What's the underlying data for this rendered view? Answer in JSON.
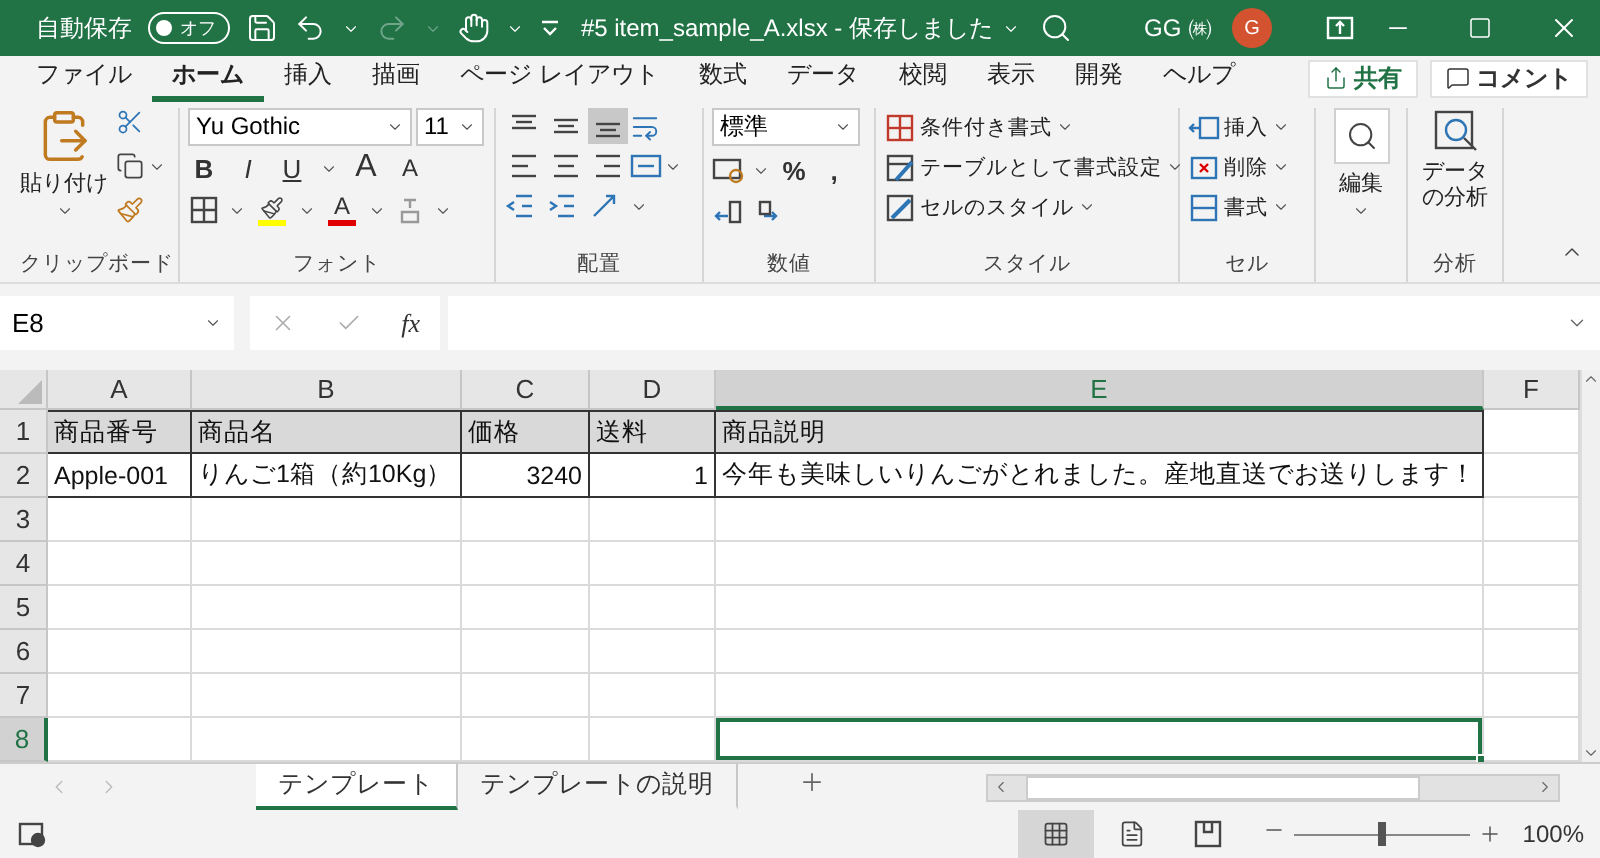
{
  "title_bar": {
    "autosave_label": "自動保存",
    "autosave_toggle": {
      "label": "オフ",
      "on": false
    },
    "title": "#5 item_sample_A.xlsx - 保存しました",
    "user": "GG ㈱",
    "avatar": "G"
  },
  "ribbon_tabs": [
    {
      "label": "ファイル",
      "selected": false
    },
    {
      "label": "ホーム",
      "selected": true
    },
    {
      "label": "挿入",
      "selected": false
    },
    {
      "label": "描画",
      "selected": false
    },
    {
      "label": "ページ レイアウト",
      "selected": false
    },
    {
      "label": "数式",
      "selected": false
    },
    {
      "label": "データ",
      "selected": false
    },
    {
      "label": "校閲",
      "selected": false
    },
    {
      "label": "表示",
      "selected": false
    },
    {
      "label": "開発",
      "selected": false
    },
    {
      "label": "ヘルプ",
      "selected": false
    }
  ],
  "share_button": "共有",
  "comment_button": "コメント",
  "ribbon": {
    "clipboard": {
      "paste": "貼り付け",
      "label": "クリップボード"
    },
    "font": {
      "name": "Yu Gothic",
      "size": "11",
      "style_buttons": [
        {
          "kind": "bold",
          "text": "B"
        },
        {
          "kind": "italic",
          "text": "I"
        },
        {
          "kind": "underline",
          "text": "U"
        },
        {
          "kind": "grow",
          "text": "A"
        },
        {
          "kind": "shrink",
          "text": "A"
        }
      ],
      "color_buttons": [
        {
          "kind": "fill",
          "color": "#ffff00"
        },
        {
          "kind": "font",
          "text": "A",
          "color": "#e00000"
        }
      ],
      "label": "フォント"
    },
    "alignment": {
      "vertical": [
        {
          "kind": "top",
          "selected": false
        },
        {
          "kind": "middle",
          "selected": false
        },
        {
          "kind": "bottom",
          "selected": true
        }
      ],
      "horizontal": [
        {
          "kind": "left",
          "selected": false
        },
        {
          "kind": "center",
          "selected": false
        },
        {
          "kind": "right",
          "selected": false
        }
      ],
      "label": "配置"
    },
    "number": {
      "format": "標準",
      "symbols": [
        "%",
        ","
      ],
      "label": "数値"
    },
    "styles": {
      "items": [
        {
          "kind": "conditional",
          "label": "条件付き書式"
        },
        {
          "kind": "table",
          "label": "テーブルとして書式設定"
        },
        {
          "kind": "cell_style",
          "label": "セルのスタイル"
        }
      ],
      "label": "スタイル"
    },
    "cells": {
      "items": [
        {
          "kind": "insert",
          "label": "挿入"
        },
        {
          "kind": "delete",
          "label": "削除"
        },
        {
          "kind": "format",
          "label": "書式"
        }
      ],
      "label": "セル"
    },
    "editing": {
      "button": "編集"
    },
    "analysis": {
      "button": "データの分析",
      "label": "分析"
    }
  },
  "formula_bar": {
    "name_box": "E8",
    "function_label": "fx"
  },
  "sheet": {
    "columns": [
      {
        "label": "A",
        "selected": false
      },
      {
        "label": "B",
        "selected": false
      },
      {
        "label": "C",
        "selected": false
      },
      {
        "label": "D",
        "selected": false
      },
      {
        "label": "E",
        "selected": true
      },
      {
        "label": "F",
        "selected": false
      }
    ],
    "rows": [
      {
        "label": "1",
        "selected": false,
        "cells": [
          {
            "kind": "header",
            "text": "商品番号",
            "selected": false
          },
          {
            "kind": "header",
            "text": "商品名",
            "selected": false
          },
          {
            "kind": "header",
            "text": "価格",
            "selected": false
          },
          {
            "kind": "header",
            "text": "送料",
            "selected": false
          },
          {
            "kind": "header",
            "text": "商品説明",
            "selected": false
          },
          {
            "kind": "plain",
            "selected": false
          }
        ]
      },
      {
        "label": "2",
        "selected": false,
        "cells": [
          {
            "kind": "data",
            "text": "Apple-001",
            "selected": false
          },
          {
            "kind": "data",
            "text": "りんご1箱（約10Kg）",
            "selected": false
          },
          {
            "kind": "number",
            "text": "3240",
            "selected": false
          },
          {
            "kind": "number",
            "text": "1",
            "selected": false
          },
          {
            "kind": "data",
            "text": "今年も美味しいりんごがとれました。産地直送でお送りします！",
            "selected": false
          },
          {
            "kind": "plain",
            "selected": false
          }
        ]
      },
      {
        "label": "3",
        "selected": false,
        "cells": [
          {
            "kind": "plain",
            "selected": false
          },
          {
            "kind": "plain",
            "selected": false
          },
          {
            "kind": "plain",
            "selected": false
          },
          {
            "kind": "plain",
            "selected": false
          },
          {
            "kind": "plain",
            "selected": false
          },
          {
            "kind": "plain",
            "selected": false
          }
        ]
      },
      {
        "label": "4",
        "selected": false,
        "cells": [
          {
            "kind": "plain",
            "selected": false
          },
          {
            "kind": "plain",
            "selected": false
          },
          {
            "kind": "plain",
            "selected": false
          },
          {
            "kind": "plain",
            "selected": false
          },
          {
            "kind": "plain",
            "selected": false
          },
          {
            "kind": "plain",
            "selected": false
          }
        ]
      },
      {
        "label": "5",
        "selected": false,
        "cells": [
          {
            "kind": "plain",
            "selected": false
          },
          {
            "kind": "plain",
            "selected": false
          },
          {
            "kind": "plain",
            "selected": false
          },
          {
            "kind": "plain",
            "selected": false
          },
          {
            "kind": "plain",
            "selected": false
          },
          {
            "kind": "plain",
            "selected": false
          }
        ]
      },
      {
        "label": "6",
        "selected": false,
        "cells": [
          {
            "kind": "plain",
            "selected": false
          },
          {
            "kind": "plain",
            "selected": false
          },
          {
            "kind": "plain",
            "selected": false
          },
          {
            "kind": "plain",
            "selected": false
          },
          {
            "kind": "plain",
            "selected": false
          },
          {
            "kind": "plain",
            "selected": false
          }
        ]
      },
      {
        "label": "7",
        "selected": false,
        "cells": [
          {
            "kind": "plain",
            "selected": false
          },
          {
            "kind": "plain",
            "selected": false
          },
          {
            "kind": "plain",
            "selected": false
          },
          {
            "kind": "plain",
            "selected": false
          },
          {
            "kind": "plain",
            "selected": false
          },
          {
            "kind": "plain",
            "selected": false
          }
        ]
      },
      {
        "label": "8",
        "selected": true,
        "cells": [
          {
            "kind": "plain",
            "selected": false
          },
          {
            "kind": "plain",
            "selected": false
          },
          {
            "kind": "plain",
            "selected": false
          },
          {
            "kind": "plain",
            "selected": false
          },
          {
            "kind": "plain",
            "selected": true
          },
          {
            "kind": "plain",
            "selected": false
          }
        ]
      }
    ]
  },
  "sheet_tabs": [
    {
      "label": "テンプレート",
      "selected": true
    },
    {
      "label": "テンプレートの説明",
      "selected": false
    }
  ],
  "status_bar": {
    "views": [
      {
        "kind": "normal",
        "selected": true
      },
      {
        "kind": "page_layout",
        "selected": false
      },
      {
        "kind": "page_break",
        "selected": false
      }
    ],
    "zoom": {
      "level": 0.5,
      "reading": "100%"
    }
  }
}
